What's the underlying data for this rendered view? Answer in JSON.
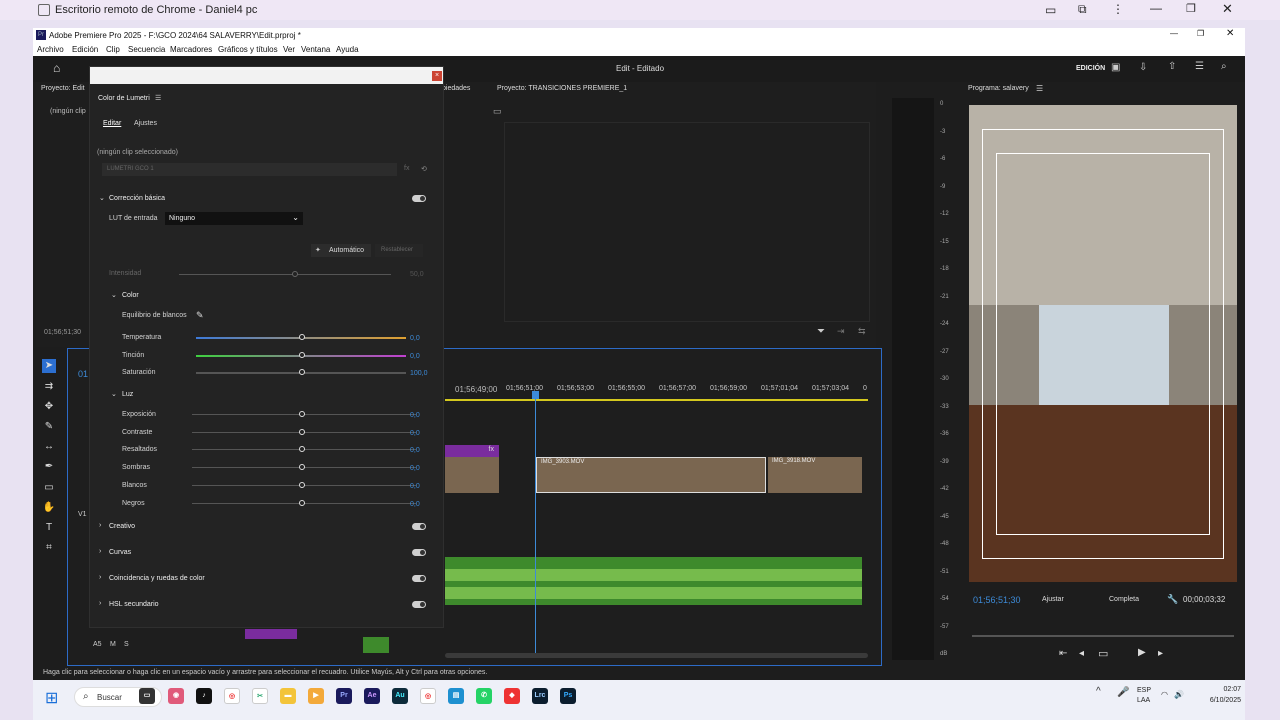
{
  "remote": {
    "title": "Escritorio remoto de Chrome - Daniel4 pc"
  },
  "premiere": {
    "title": "Adobe Premiere Pro 2025 - F:\\GCO 2024\\64 SALAVERRY\\Edit.prproj *",
    "menu": [
      "Archivo",
      "Edición",
      "Clip",
      "Secuencia",
      "Marcadores",
      "Gráficos y títulos",
      "Ver",
      "Ventana",
      "Ayuda"
    ],
    "workspace_title": "Edit - Editado",
    "workspace_mode": "EDICIÓN"
  },
  "source_panel": {
    "tab": "Proyecto: Edit",
    "tab_props": "piedades",
    "project_tab": "Proyecto: TRANSICIONES PREMIERE_1",
    "no_clip": "(ningún clip",
    "timecode": "01;56;51;30"
  },
  "lumetri": {
    "panel_title": "Color de Lumetri",
    "tabs": [
      "Editar",
      "Ajustes"
    ],
    "no_clip": "(ningún clip seleccionado)",
    "preset": "LUMETRI GCO 1",
    "basic_section": "Corrección básica",
    "lut_label": "LUT de entrada",
    "lut_value": "Ninguno",
    "auto": "Automático",
    "reset": "Restablecer",
    "intensity_label": "Intensidad",
    "intensity_value": "50,0",
    "color_section": "Color",
    "wb_label": "Equilibrio de blancos",
    "color_sliders": [
      {
        "label": "Temperatura",
        "value": "0,0"
      },
      {
        "label": "Tinción",
        "value": "0,0"
      },
      {
        "label": "Saturación",
        "value": "100,0"
      }
    ],
    "light_section": "Luz",
    "light_sliders": [
      {
        "label": "Exposición",
        "value": "0,0"
      },
      {
        "label": "Contraste",
        "value": "0,0"
      },
      {
        "label": "Resaltados",
        "value": "0,0"
      },
      {
        "label": "Sombras",
        "value": "0,0"
      },
      {
        "label": "Blancos",
        "value": "0,0"
      },
      {
        "label": "Negros",
        "value": "0,0"
      }
    ],
    "sections": [
      "Creativo",
      "Curvas",
      "Coincidencia y ruedas de color",
      "HSL secundario"
    ]
  },
  "timeline": {
    "timecode": "01",
    "ruler": [
      "01;56;49;00",
      "01;56;51;00",
      "01;56;53;00",
      "01;56;55;00",
      "01;56;57;00",
      "01;56;59;00",
      "01;57;01;04",
      "01;57;03;04",
      "0"
    ],
    "clips": [
      "IMG_3903.MOV",
      "IMG_3918.MOV"
    ],
    "fx": "fx",
    "track_v1": "V1",
    "track_a": [
      "A5",
      "M",
      "S"
    ]
  },
  "meter": {
    "scale": [
      "0",
      "-3",
      "-6",
      "-9",
      "-12",
      "-15",
      "-18",
      "-21",
      "-24",
      "-27",
      "-30",
      "-33",
      "-36",
      "-39",
      "-42",
      "-45",
      "-48",
      "-51",
      "-54",
      "-57",
      "dB"
    ]
  },
  "program": {
    "tab": "Programa: salavery",
    "timecode": "01;56;51;30",
    "fit": "Ajustar",
    "quality": "Completa",
    "duration": "00;00;03;32"
  },
  "status": "Haga clic para seleccionar o haga clic en un espacio vacío y arrastre para seleccionar el recuadro. Utilice Mayús, Alt y Ctrl para otras opciones.",
  "taskbar": {
    "search": "Buscar",
    "lang": "ESP",
    "lang2": "LAA",
    "time": "02:07",
    "date": "6/10/2025"
  }
}
